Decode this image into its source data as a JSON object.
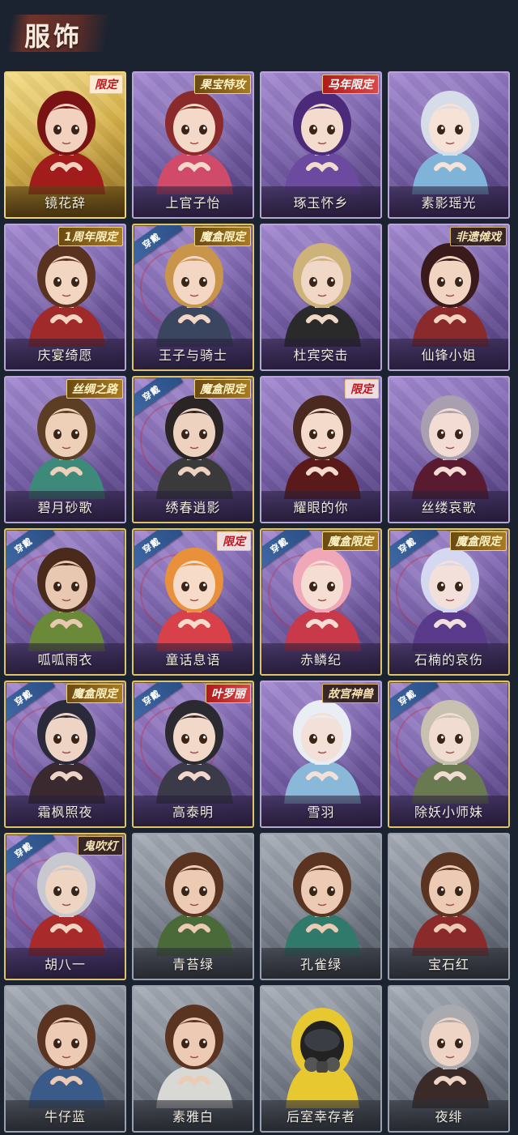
{
  "page": {
    "title": "服饰"
  },
  "worn_label": "穿戴",
  "colors": {
    "background": "#1c2330",
    "purple_card": "#7b63ad",
    "gold_card": "#d7b24a",
    "gray_card": "#777e8a",
    "worn_tag": "#3f6aa8"
  },
  "costumes": [
    {
      "name": "镜花辞",
      "badge": "限定",
      "badge_style": "red",
      "rarity": "gold",
      "worn": false,
      "hair": "#7a1414",
      "outfit": "#a31c1c",
      "skin": "#f2d2bf"
    },
    {
      "name": "上官子怡",
      "badge": "果宝特攻",
      "badge_style": "gold",
      "rarity": "purple",
      "worn": false,
      "hair": "#8a2a2a",
      "outfit": "#d04a6a",
      "skin": "#f4d8c8"
    },
    {
      "name": "琢玉怀乡",
      "badge": "马年限定",
      "badge_style": "redfill",
      "rarity": "purple",
      "worn": false,
      "hair": "#4b2a7a",
      "outfit": "#6c4aa0",
      "skin": "#f3dccd"
    },
    {
      "name": "素影瑶光",
      "badge": "",
      "badge_style": "",
      "rarity": "purple",
      "worn": false,
      "hair": "#d6dde8",
      "outfit": "#7fb4d8",
      "skin": "#f6e2d6"
    },
    {
      "name": "庆宴绮愿",
      "badge": "1周年限定",
      "badge_style": "gold",
      "rarity": "purple",
      "worn": false,
      "hair": "#5a3220",
      "outfit": "#a02a2a",
      "skin": "#f3d6c2"
    },
    {
      "name": "王子与骑士",
      "badge": "魔盒限定",
      "badge_style": "gold",
      "rarity": "purple",
      "worn": true,
      "hair": "#c8954a",
      "outfit": "#3a4560",
      "skin": "#f3d7c4"
    },
    {
      "name": "杜宾突击",
      "badge": "",
      "badge_style": "",
      "rarity": "purple",
      "worn": false,
      "hair": "#cdb37a",
      "outfit": "#2a2a2a",
      "skin": "#f1d8c6"
    },
    {
      "name": "仙锋小姐",
      "badge": "非遗傩戏",
      "badge_style": "black",
      "rarity": "purple",
      "worn": false,
      "hair": "#3a1a1a",
      "outfit": "#8a2a2a",
      "skin": "#f2d4c2"
    },
    {
      "name": "碧月砂歌",
      "badge": "丝绸之路",
      "badge_style": "gold",
      "rarity": "purple",
      "worn": false,
      "hair": "#5c3e25",
      "outfit": "#3e8a7a",
      "skin": "#eed0b8"
    },
    {
      "name": "绣春逍影",
      "badge": "魔盒限定",
      "badge_style": "gold",
      "rarity": "purple",
      "worn": true,
      "hair": "#2a2424",
      "outfit": "#3a3a3a",
      "skin": "#eed2c0"
    },
    {
      "name": "耀眼的你",
      "badge": "限定",
      "badge_style": "red",
      "rarity": "purple",
      "worn": false,
      "hair": "#4a2a20",
      "outfit": "#5a1a1a",
      "skin": "#f4dacb"
    },
    {
      "name": "丝缕哀歌",
      "badge": "",
      "badge_style": "",
      "rarity": "purple",
      "worn": false,
      "hair": "#a8a0b0",
      "outfit": "#5a1a30",
      "skin": "#f3dcd4"
    },
    {
      "name": "呱呱雨衣",
      "badge": "",
      "badge_style": "",
      "rarity": "purple",
      "worn": true,
      "hair": "#4a2a1a",
      "outfit": "#6a8a3a",
      "skin": "#e8c8b0"
    },
    {
      "name": "童话息语",
      "badge": "限定",
      "badge_style": "red",
      "rarity": "purple",
      "worn": true,
      "hair": "#e8903a",
      "outfit": "#d8404a",
      "skin": "#f6dcc8"
    },
    {
      "name": "赤鳞纪",
      "badge": "魔盒限定",
      "badge_style": "gold",
      "rarity": "purple",
      "worn": true,
      "hair": "#f0a8b8",
      "outfit": "#c83a4a",
      "skin": "#f6ddd4"
    },
    {
      "name": "石楠的哀伤",
      "badge": "魔盒限定",
      "badge_style": "gold",
      "rarity": "purple",
      "worn": true,
      "hair": "#d4d8f0",
      "outfit": "#5a3a8a",
      "skin": "#f3e0da"
    },
    {
      "name": "霜枫照夜",
      "badge": "魔盒限定",
      "badge_style": "gold",
      "rarity": "purple",
      "worn": true,
      "hair": "#2a2a3a",
      "outfit": "#3a2a30",
      "skin": "#eed4c4"
    },
    {
      "name": "高泰明",
      "badge": "叶罗丽",
      "badge_style": "redfill",
      "rarity": "purple",
      "worn": true,
      "hair": "#2a2a30",
      "outfit": "#3a3a48",
      "skin": "#f1d8c8"
    },
    {
      "name": "雪羽",
      "badge": "故宫神兽",
      "badge_style": "black",
      "rarity": "purple",
      "worn": false,
      "hair": "#e8eef4",
      "outfit": "#8ab8d8",
      "skin": "#f3e0d8"
    },
    {
      "name": "除妖小师妹",
      "badge": "",
      "badge_style": "",
      "rarity": "purple",
      "worn": true,
      "hair": "#c8c0b0",
      "outfit": "#6a7a50",
      "skin": "#f0dcd0"
    },
    {
      "name": "胡八一",
      "badge": "鬼吹灯",
      "badge_style": "black",
      "rarity": "purple",
      "worn": true,
      "hair": "#c8c8d0",
      "outfit": "#a82a2a",
      "skin": "#eed4c2"
    },
    {
      "name": "青苔绿",
      "badge": "",
      "badge_style": "",
      "rarity": "gray",
      "worn": false,
      "hair": "#5a3420",
      "outfit": "#4a6a3a",
      "skin": "#eccab4"
    },
    {
      "name": "孔雀绿",
      "badge": "",
      "badge_style": "",
      "rarity": "gray",
      "worn": false,
      "hair": "#5a3420",
      "outfit": "#2f7a6a",
      "skin": "#eccab4"
    },
    {
      "name": "宝石红",
      "badge": "",
      "badge_style": "",
      "rarity": "gray",
      "worn": false,
      "hair": "#5a3420",
      "outfit": "#8a2a2a",
      "skin": "#eccab4"
    },
    {
      "name": "牛仔蓝",
      "badge": "",
      "badge_style": "",
      "rarity": "gray",
      "worn": false,
      "hair": "#5a3420",
      "outfit": "#3a5a8a",
      "skin": "#eccab4"
    },
    {
      "name": "素雅白",
      "badge": "",
      "badge_style": "",
      "rarity": "gray",
      "worn": false,
      "hair": "#5a3420",
      "outfit": "#d8d8d4",
      "skin": "#eccab4"
    },
    {
      "name": "后室幸存者",
      "badge": "",
      "badge_style": "",
      "rarity": "gray",
      "worn": false,
      "hair": "#1a1a1a",
      "outfit": "#e8c830",
      "skin": "#222222"
    },
    {
      "name": "夜绯",
      "badge": "",
      "badge_style": "",
      "rarity": "gray",
      "worn": false,
      "hair": "#a8aab0",
      "outfit": "#3a2a28",
      "skin": "#eed4c4"
    }
  ]
}
